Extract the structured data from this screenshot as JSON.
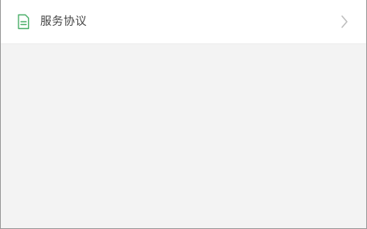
{
  "menu": {
    "items": [
      {
        "label": "服务协议",
        "icon": "document-icon",
        "trailing_icon": "chevron-right-icon"
      }
    ]
  },
  "colors": {
    "icon_accent": "#4caf6a",
    "chevron": "#bdbdbd",
    "background": "#f3f3f3",
    "row_background": "#ffffff"
  }
}
